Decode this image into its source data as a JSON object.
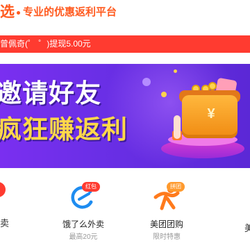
{
  "header": {
    "brand_fragment": "选",
    "slogan": "专业的优惠返利平台"
  },
  "notice": {
    "text": "曾佩奇(゜ ゜)提现5.00元"
  },
  "banner": {
    "headline_line1": "邀请好友",
    "headline_line2": "疯狂赚返利"
  },
  "nav": {
    "items": [
      {
        "label": "饿了么外卖",
        "subtitle": "最高20元",
        "tag": "红包",
        "icon": "eleme-icon"
      },
      {
        "label": "美团团购",
        "subtitle": "限时特惠",
        "tag": "拼团",
        "icon": "meituan-icon"
      }
    ],
    "partial_left_label": "卖",
    "colors": {
      "eleme": "#1e8cf0",
      "meituan": "#ff7a1c",
      "tag_red": "#ff3b30",
      "tag_orange": "#ff9a2e"
    }
  },
  "colors": {
    "brand": "#ff5a1f",
    "notice_bg": "#ff3b30",
    "banner_bg": "#6a2fe6",
    "headline_yellow": "#ffd84a"
  }
}
